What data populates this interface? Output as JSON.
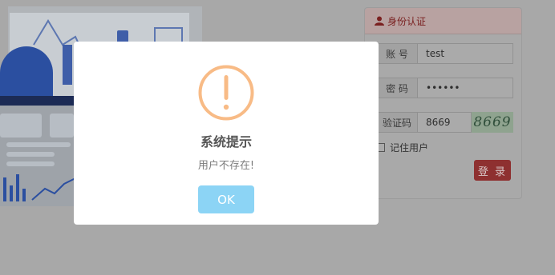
{
  "login": {
    "header": "身份认证",
    "account_label": "账 号",
    "account_value": "test",
    "password_label": "密 码",
    "password_value": "••••••",
    "captcha_label": "验证码",
    "captcha_value": "8669",
    "captcha_image_text": "8669",
    "remember_label": "记住用户",
    "login_button": "登 录"
  },
  "dialog": {
    "icon": "warning-icon",
    "title": "系统提示",
    "message": "用户不存在!",
    "ok_button": "OK",
    "accent_color": "#f8bb86",
    "button_color": "#8cd4f5"
  },
  "colors": {
    "overlay": "#a8a8a8",
    "login_button": "#8e3030"
  }
}
